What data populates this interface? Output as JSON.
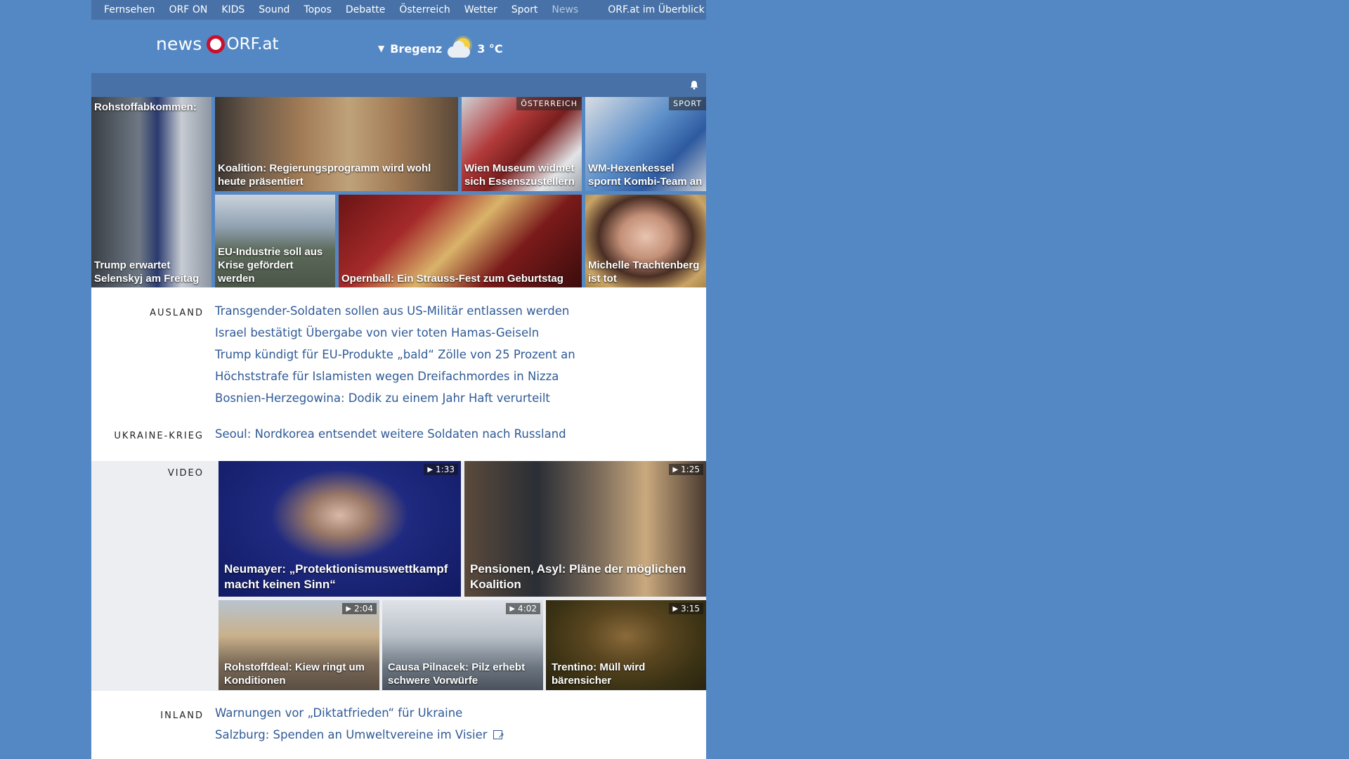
{
  "topnav": {
    "items": [
      "Fernsehen",
      "ORF ON",
      "KIDS",
      "Sound",
      "Topos",
      "Debatte",
      "Österreich",
      "Wetter",
      "Sport",
      "News"
    ],
    "overview": "ORF.at im Überblick"
  },
  "brand": {
    "news": "news",
    "orf": "ORF.at"
  },
  "weather": {
    "city": "Bregenz",
    "temp": "3 °C",
    "icon": "partly-cloudy-icon"
  },
  "topstories": [
    {
      "title_top": "Rohstoffabkommen:",
      "title": "Trump erwartet Selenskyj am Freitag"
    },
    {
      "title": "Koalition: Regierungsprogramm wird wohl heute präsentiert"
    },
    {
      "title": "Wien Museum widmet sich Essenszustellern",
      "badge": "ÖSTERREICH"
    },
    {
      "title": "WM-Hexenkessel spornt Kombi-Team an",
      "badge": "SPORT"
    },
    {
      "title": "EU-Industrie soll aus Krise gefördert werden"
    },
    {
      "title": "Opernball: Ein Strauss-Fest zum Geburtstag"
    },
    {
      "title": "Michelle Trachtenberg ist tot"
    }
  ],
  "sections": {
    "ausland": {
      "label": "AUSLAND",
      "links": [
        "Transgender-Soldaten sollen aus US-Militär entlassen werden",
        "Israel bestätigt Übergabe von vier toten Hamas-Geiseln",
        "Trump kündigt für EU-Produkte „bald“ Zölle von 25 Prozent an",
        "Höchststrafe für Islamisten wegen Dreifachmordes in Nizza",
        "Bosnien-Herzegowina: Dodik zu einem Jahr Haft verurteilt"
      ]
    },
    "ukraine": {
      "label": "UKRAINE-KRIEG",
      "links": [
        "Seoul: Nordkorea entsendet weitere Soldaten nach Russland"
      ]
    },
    "video": {
      "label": "VIDEO",
      "items": [
        {
          "title": "Neumayer: „Protektionismuswettkampf macht keinen Sinn“",
          "duration": "1:33"
        },
        {
          "title": "Pensionen, Asyl: Pläne der möglichen Koalition",
          "duration": "1:25"
        },
        {
          "title": "Rohstoffdeal: Kiew ringt um Konditionen",
          "duration": "2:04"
        },
        {
          "title": "Causa Pilnacek: Pilz erhebt schwere Vorwürfe",
          "duration": "4:02"
        },
        {
          "title": "Trentino: Müll wird bärensicher",
          "duration": "3:15"
        }
      ]
    },
    "inland": {
      "label": "INLAND",
      "links": [
        "Warnungen vor „Diktatfrieden“ für Ukraine",
        "Salzburg: Spenden an Umweltvereine im Visier"
      ]
    }
  }
}
